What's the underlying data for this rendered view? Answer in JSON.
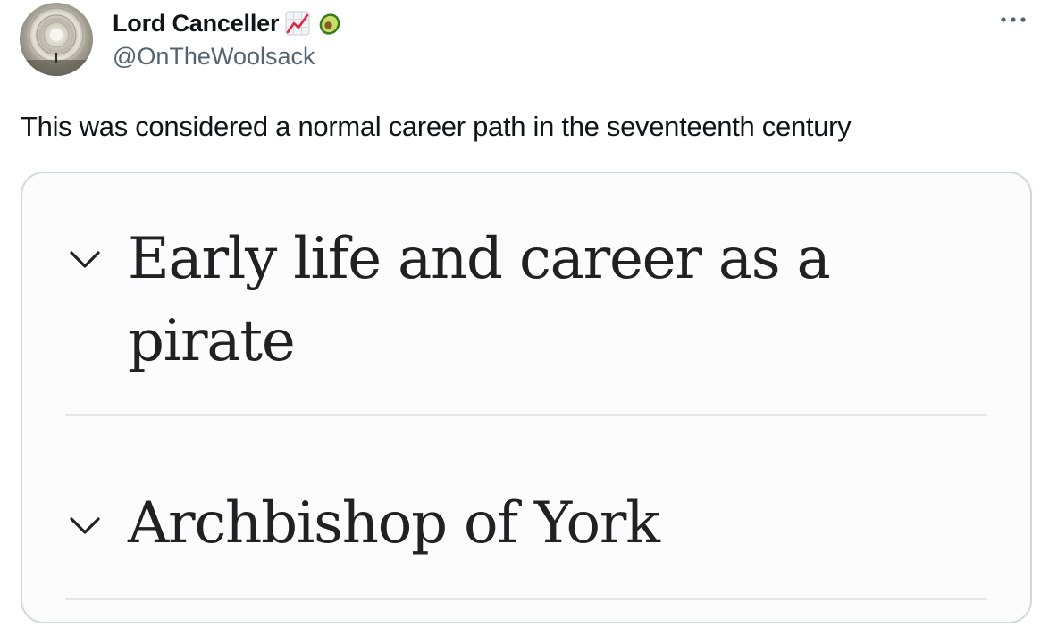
{
  "tweet": {
    "author": {
      "display_name": "Lord Canceller",
      "handle": "@OnTheWoolsack",
      "badges": [
        "chart-increasing-emoji",
        "avocado-emoji"
      ]
    },
    "more_icon": "ellipsis-icon",
    "text": "This was considered a normal career path in the seventeenth century"
  },
  "card": {
    "sections": [
      {
        "title_line1": "Early life and career as a",
        "title_line2": "pirate",
        "icon": "chevron-down-icon"
      },
      {
        "title": "Archbishop of York",
        "icon": "chevron-down-icon"
      }
    ]
  },
  "colors": {
    "text_primary": "#0f1419",
    "text_secondary": "#536471",
    "card_border": "#cfd9de",
    "heading_text": "#202122",
    "divider": "#e4e6e8"
  }
}
